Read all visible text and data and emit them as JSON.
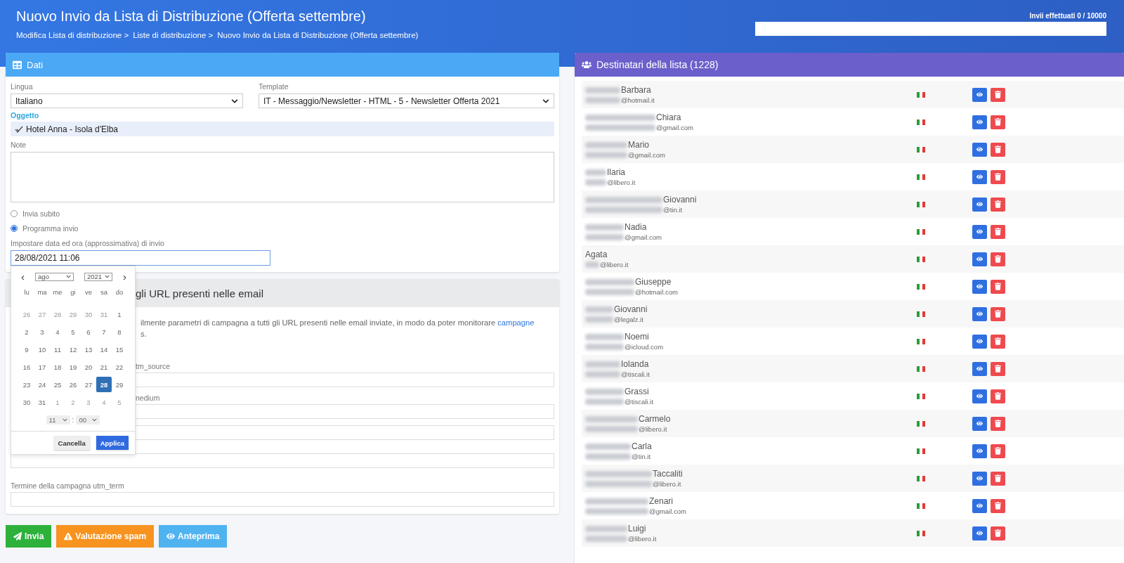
{
  "header": {
    "title": "Nuovo Invio da Lista di Distribuzione (Offerta settembre)",
    "breadcrumbs": [
      "Modifica Lista di distribuzione >",
      "Liste di distribuzione >",
      "Nuovo Invio da Lista di Distribuzione (Offerta settembre)"
    ],
    "quota": {
      "label": "Invii effettuati 0 / 10000",
      "level": 0
    }
  },
  "dati": {
    "title": "Dati",
    "lingua": {
      "label": "Lingua",
      "value": "Italiano"
    },
    "template": {
      "label": "Template",
      "value": "IT - Messaggio/Newsletter - HTML - 5 - Newsletter Offerta 2021"
    },
    "oggetto": {
      "label": "Oggetto",
      "value": "Hotel Anna - Isola d'Elba"
    },
    "note": {
      "label": "Note"
    },
    "radios": [
      {
        "label": "Invia subito",
        "selected": false
      },
      {
        "label": "Programma invio",
        "selected": true
      }
    ],
    "datetime": {
      "label": "Impostare data ed ora (approssimativa) di invio",
      "value": "28/08/2021 11:06"
    }
  },
  "datepicker": {
    "prev": "‹",
    "next": "›",
    "month": "ago",
    "year": "2021",
    "weekdays": [
      "lu",
      "ma",
      "me",
      "gi",
      "ve",
      "sa",
      "do"
    ],
    "weeks": [
      [
        {
          "d": "26",
          "muted": true,
          "selected": false
        },
        {
          "d": "27",
          "muted": true,
          "selected": false
        },
        {
          "d": "28",
          "muted": true,
          "selected": false
        },
        {
          "d": "29",
          "muted": true,
          "selected": false
        },
        {
          "d": "30",
          "muted": true,
          "selected": false
        },
        {
          "d": "31",
          "muted": true,
          "selected": false
        },
        {
          "d": "1",
          "muted": false,
          "selected": false
        }
      ],
      [
        {
          "d": "2",
          "muted": false,
          "selected": false
        },
        {
          "d": "3",
          "muted": false,
          "selected": false
        },
        {
          "d": "4",
          "muted": false,
          "selected": false
        },
        {
          "d": "5",
          "muted": false,
          "selected": false
        },
        {
          "d": "6",
          "muted": false,
          "selected": false
        },
        {
          "d": "7",
          "muted": false,
          "selected": false
        },
        {
          "d": "8",
          "muted": false,
          "selected": false
        }
      ],
      [
        {
          "d": "9",
          "muted": false,
          "selected": false
        },
        {
          "d": "10",
          "muted": false,
          "selected": false
        },
        {
          "d": "11",
          "muted": false,
          "selected": false
        },
        {
          "d": "12",
          "muted": false,
          "selected": false
        },
        {
          "d": "13",
          "muted": false,
          "selected": false
        },
        {
          "d": "14",
          "muted": false,
          "selected": false
        },
        {
          "d": "15",
          "muted": false,
          "selected": false
        }
      ],
      [
        {
          "d": "16",
          "muted": false,
          "selected": false
        },
        {
          "d": "17",
          "muted": false,
          "selected": false
        },
        {
          "d": "18",
          "muted": false,
          "selected": false
        },
        {
          "d": "19",
          "muted": false,
          "selected": false
        },
        {
          "d": "20",
          "muted": false,
          "selected": false
        },
        {
          "d": "21",
          "muted": false,
          "selected": false
        },
        {
          "d": "22",
          "muted": false,
          "selected": false
        }
      ],
      [
        {
          "d": "23",
          "muted": false,
          "selected": false
        },
        {
          "d": "24",
          "muted": false,
          "selected": false
        },
        {
          "d": "25",
          "muted": false,
          "selected": false
        },
        {
          "d": "26",
          "muted": false,
          "selected": false
        },
        {
          "d": "27",
          "muted": false,
          "selected": false
        },
        {
          "d": "28",
          "muted": false,
          "selected": true
        },
        {
          "d": "29",
          "muted": false,
          "selected": false
        }
      ],
      [
        {
          "d": "30",
          "muted": false,
          "selected": false
        },
        {
          "d": "31",
          "muted": false,
          "selected": false
        },
        {
          "d": "1",
          "muted": true,
          "selected": false
        },
        {
          "d": "2",
          "muted": true,
          "selected": false
        },
        {
          "d": "3",
          "muted": true,
          "selected": false
        },
        {
          "d": "4",
          "muted": true,
          "selected": false
        },
        {
          "d": "5",
          "muted": true,
          "selected": false
        }
      ]
    ],
    "hour": "11",
    "separator": ":",
    "minute": "00",
    "cancel": "Cancella",
    "apply": "Applica"
  },
  "utm": {
    "title": "gli URL presenti nelle email",
    "description": "ilmente parametri di campagna a tutti gli URL presenti nelle email inviate, in modo da poter monitorare ",
    "link": "campagne",
    "description_2": "s.",
    "fields": [
      {
        "kind": "partial",
        "label": "tm_source"
      },
      {
        "kind": "partial",
        "label": "nedium"
      },
      {
        "kind": "bare"
      },
      {
        "kind": "bare"
      },
      {
        "kind": "full",
        "label": "Termine della campagna utm_term"
      }
    ]
  },
  "actions": [
    {
      "kind": "send",
      "label": "Invia"
    },
    {
      "kind": "spam",
      "label": "Valutazione spam"
    },
    {
      "kind": "preview",
      "label": "Anteprima"
    }
  ],
  "recipients": {
    "title": "Destinatari della lista (1228)",
    "rows": [
      {
        "name": "Barbara",
        "email": "@hotmail.it"
      },
      {
        "name": "Chiara",
        "email": "@gmail.com"
      },
      {
        "name": "Mario",
        "email": "@gmail.com"
      },
      {
        "name": "Ilaria",
        "email": "@libero.it"
      },
      {
        "name": "Giovanni",
        "email": "@tin.it"
      },
      {
        "name": "Nadia",
        "email": "@gmail.com"
      },
      {
        "name": "Agata",
        "email": "@libero.it"
      },
      {
        "name": "Giuseppe",
        "email": "@hotmail.com"
      },
      {
        "name": "Giovanni",
        "email": "@legalz.it"
      },
      {
        "name": "Noemi",
        "email": "@icloud.com"
      },
      {
        "name": "Iolanda",
        "email": "@tiscali.it"
      },
      {
        "name": "Grassi",
        "email": "@tiscali.it"
      },
      {
        "name": "Carmelo",
        "email": "@libero.it"
      },
      {
        "name": "Carla",
        "email": "@tin.it"
      },
      {
        "name": "Taccaliti",
        "email": "@libero.it"
      },
      {
        "name": "Zenari",
        "email": "@gmail.com"
      },
      {
        "name": "Luigi",
        "email": "@libero.it"
      }
    ]
  }
}
